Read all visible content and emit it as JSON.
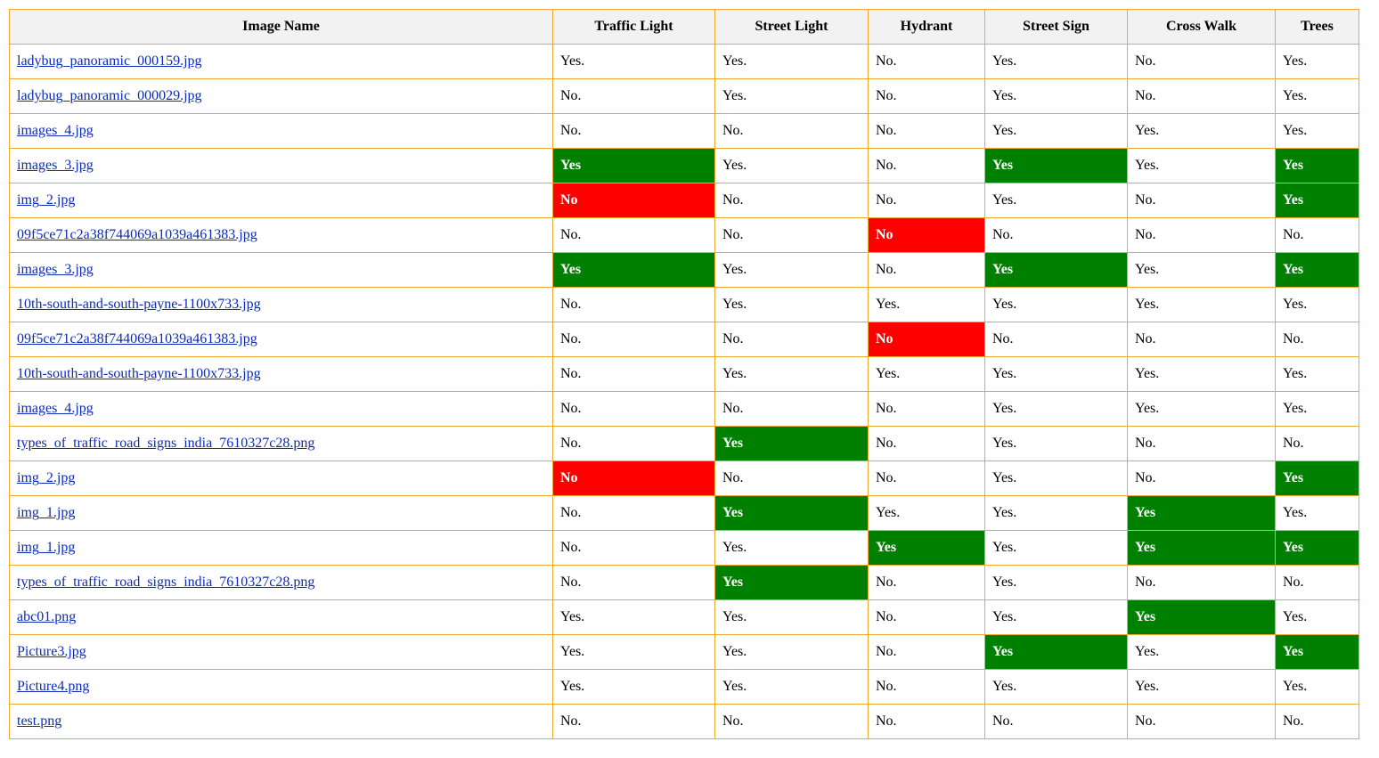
{
  "table": {
    "headers": [
      "Image Name",
      "Traffic Light",
      "Street Light",
      "Hydrant",
      "Street Sign",
      "Cross Walk",
      "Trees"
    ],
    "colors": {
      "border": "#f0a830",
      "header_bg": "#f2f2f2",
      "green": "#008000",
      "red": "#ff0000",
      "link": "#0b2bb8"
    },
    "rows": [
      {
        "name": "ladybug_panoramic_000159.jpg",
        "cells": [
          {
            "text": "Yes.",
            "mark": ""
          },
          {
            "text": "Yes.",
            "mark": ""
          },
          {
            "text": "No.",
            "mark": ""
          },
          {
            "text": "Yes.",
            "mark": ""
          },
          {
            "text": "No.",
            "mark": ""
          },
          {
            "text": "Yes.",
            "mark": ""
          }
        ]
      },
      {
        "name": "ladybug_panoramic_000029.jpg",
        "cells": [
          {
            "text": "No.",
            "mark": ""
          },
          {
            "text": "Yes.",
            "mark": ""
          },
          {
            "text": "No.",
            "mark": ""
          },
          {
            "text": "Yes.",
            "mark": ""
          },
          {
            "text": "No.",
            "mark": ""
          },
          {
            "text": "Yes.",
            "mark": ""
          }
        ]
      },
      {
        "name": "images_4.jpg",
        "cells": [
          {
            "text": "No.",
            "mark": ""
          },
          {
            "text": "No.",
            "mark": ""
          },
          {
            "text": "No.",
            "mark": ""
          },
          {
            "text": "Yes.",
            "mark": ""
          },
          {
            "text": "Yes.",
            "mark": ""
          },
          {
            "text": "Yes.",
            "mark": ""
          }
        ]
      },
      {
        "name": "images_3.jpg",
        "cells": [
          {
            "text": "Yes",
            "mark": "green"
          },
          {
            "text": "Yes.",
            "mark": ""
          },
          {
            "text": "No.",
            "mark": ""
          },
          {
            "text": "Yes",
            "mark": "green"
          },
          {
            "text": "Yes.",
            "mark": ""
          },
          {
            "text": "Yes",
            "mark": "green"
          }
        ]
      },
      {
        "name": "img_2.jpg",
        "cells": [
          {
            "text": "No",
            "mark": "red"
          },
          {
            "text": "No.",
            "mark": ""
          },
          {
            "text": "No.",
            "mark": ""
          },
          {
            "text": "Yes.",
            "mark": ""
          },
          {
            "text": "No.",
            "mark": ""
          },
          {
            "text": "Yes",
            "mark": "green"
          }
        ]
      },
      {
        "name": "09f5ce71c2a38f744069a1039a461383.jpg",
        "cells": [
          {
            "text": "No.",
            "mark": ""
          },
          {
            "text": "No.",
            "mark": ""
          },
          {
            "text": "No",
            "mark": "red"
          },
          {
            "text": "No.",
            "mark": ""
          },
          {
            "text": "No.",
            "mark": ""
          },
          {
            "text": "No.",
            "mark": ""
          }
        ]
      },
      {
        "name": "images_3.jpg",
        "cells": [
          {
            "text": "Yes",
            "mark": "green"
          },
          {
            "text": "Yes.",
            "mark": ""
          },
          {
            "text": "No.",
            "mark": ""
          },
          {
            "text": "Yes",
            "mark": "green"
          },
          {
            "text": "Yes.",
            "mark": ""
          },
          {
            "text": "Yes",
            "mark": "green"
          }
        ]
      },
      {
        "name": "10th-south-and-south-payne-1100x733.jpg",
        "cells": [
          {
            "text": "No.",
            "mark": ""
          },
          {
            "text": "Yes.",
            "mark": ""
          },
          {
            "text": "Yes.",
            "mark": ""
          },
          {
            "text": "Yes.",
            "mark": ""
          },
          {
            "text": "Yes.",
            "mark": ""
          },
          {
            "text": "Yes.",
            "mark": ""
          }
        ]
      },
      {
        "name": "09f5ce71c2a38f744069a1039a461383.jpg",
        "cells": [
          {
            "text": "No.",
            "mark": ""
          },
          {
            "text": "No.",
            "mark": ""
          },
          {
            "text": "No",
            "mark": "red"
          },
          {
            "text": "No.",
            "mark": ""
          },
          {
            "text": "No.",
            "mark": ""
          },
          {
            "text": "No.",
            "mark": ""
          }
        ]
      },
      {
        "name": "10th-south-and-south-payne-1100x733.jpg",
        "cells": [
          {
            "text": "No.",
            "mark": ""
          },
          {
            "text": "Yes.",
            "mark": ""
          },
          {
            "text": "Yes.",
            "mark": ""
          },
          {
            "text": "Yes.",
            "mark": ""
          },
          {
            "text": "Yes.",
            "mark": ""
          },
          {
            "text": "Yes.",
            "mark": ""
          }
        ]
      },
      {
        "name": "images_4.jpg",
        "cells": [
          {
            "text": "No.",
            "mark": ""
          },
          {
            "text": "No.",
            "mark": ""
          },
          {
            "text": "No.",
            "mark": ""
          },
          {
            "text": "Yes.",
            "mark": ""
          },
          {
            "text": "Yes.",
            "mark": ""
          },
          {
            "text": "Yes.",
            "mark": ""
          }
        ]
      },
      {
        "name": "types_of_traffic_road_signs_india_7610327c28.png",
        "cells": [
          {
            "text": "No.",
            "mark": ""
          },
          {
            "text": "Yes",
            "mark": "green"
          },
          {
            "text": "No.",
            "mark": ""
          },
          {
            "text": "Yes.",
            "mark": ""
          },
          {
            "text": "No.",
            "mark": ""
          },
          {
            "text": "No.",
            "mark": ""
          }
        ]
      },
      {
        "name": "img_2.jpg",
        "cells": [
          {
            "text": "No",
            "mark": "red"
          },
          {
            "text": "No.",
            "mark": ""
          },
          {
            "text": "No.",
            "mark": ""
          },
          {
            "text": "Yes.",
            "mark": ""
          },
          {
            "text": "No.",
            "mark": ""
          },
          {
            "text": "Yes",
            "mark": "green"
          }
        ]
      },
      {
        "name": "img_1.jpg",
        "cells": [
          {
            "text": "No.",
            "mark": ""
          },
          {
            "text": "Yes",
            "mark": "green"
          },
          {
            "text": "Yes.",
            "mark": ""
          },
          {
            "text": "Yes.",
            "mark": ""
          },
          {
            "text": "Yes",
            "mark": "green"
          },
          {
            "text": "Yes.",
            "mark": ""
          }
        ]
      },
      {
        "name": "img_1.jpg",
        "cells": [
          {
            "text": "No.",
            "mark": ""
          },
          {
            "text": "Yes.",
            "mark": ""
          },
          {
            "text": "Yes",
            "mark": "green"
          },
          {
            "text": "Yes.",
            "mark": ""
          },
          {
            "text": "Yes",
            "mark": "green"
          },
          {
            "text": "Yes",
            "mark": "green"
          }
        ]
      },
      {
        "name": "types_of_traffic_road_signs_india_7610327c28.png",
        "cells": [
          {
            "text": "No.",
            "mark": ""
          },
          {
            "text": "Yes",
            "mark": "green"
          },
          {
            "text": "No.",
            "mark": ""
          },
          {
            "text": "Yes.",
            "mark": ""
          },
          {
            "text": "No.",
            "mark": ""
          },
          {
            "text": "No.",
            "mark": ""
          }
        ]
      },
      {
        "name": "abc01.png",
        "cells": [
          {
            "text": "Yes.",
            "mark": ""
          },
          {
            "text": "Yes.",
            "mark": ""
          },
          {
            "text": "No.",
            "mark": ""
          },
          {
            "text": "Yes.",
            "mark": ""
          },
          {
            "text": "Yes",
            "mark": "green"
          },
          {
            "text": "Yes.",
            "mark": ""
          }
        ]
      },
      {
        "name": "Picture3.jpg",
        "cells": [
          {
            "text": "Yes.",
            "mark": ""
          },
          {
            "text": "Yes.",
            "mark": ""
          },
          {
            "text": "No.",
            "mark": ""
          },
          {
            "text": "Yes",
            "mark": "green"
          },
          {
            "text": "Yes.",
            "mark": ""
          },
          {
            "text": "Yes",
            "mark": "green"
          }
        ]
      },
      {
        "name": "Picture4.png",
        "cells": [
          {
            "text": "Yes.",
            "mark": ""
          },
          {
            "text": "Yes.",
            "mark": ""
          },
          {
            "text": "No.",
            "mark": ""
          },
          {
            "text": "Yes.",
            "mark": ""
          },
          {
            "text": "Yes.",
            "mark": ""
          },
          {
            "text": "Yes.",
            "mark": ""
          }
        ]
      },
      {
        "name": "test.png",
        "cells": [
          {
            "text": "No.",
            "mark": ""
          },
          {
            "text": "No.",
            "mark": ""
          },
          {
            "text": "No.",
            "mark": ""
          },
          {
            "text": "No.",
            "mark": ""
          },
          {
            "text": "No.",
            "mark": ""
          },
          {
            "text": "No.",
            "mark": ""
          }
        ]
      }
    ]
  }
}
